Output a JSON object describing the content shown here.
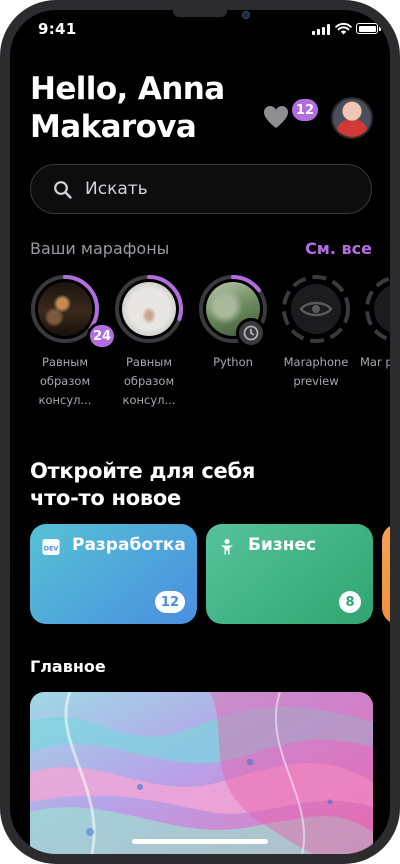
{
  "status_bar": {
    "time": "9:41"
  },
  "header": {
    "greeting_line1": "Hello, Anna",
    "greeting_line2": "Makarova",
    "favorites_count": "12"
  },
  "search": {
    "placeholder": "Искать"
  },
  "marathons": {
    "title": "Ваши марафоны",
    "see_all": "См. все",
    "items": [
      {
        "label": "Равным образом консул...",
        "badge": "24",
        "progress": 0.35
      },
      {
        "label": "Равным образом консул...",
        "progress": 0.3
      },
      {
        "label": "Python",
        "progress": 0.15
      },
      {
        "label": "Maraphone preview"
      },
      {
        "label": "Mar pr"
      }
    ]
  },
  "discover": {
    "title_line1": "Откройте для себя",
    "title_line2": "что-то новое",
    "categories": [
      {
        "name": "Разработка",
        "count": "12",
        "color": "#4c99e0",
        "icon": "dev-icon"
      },
      {
        "name": "Бизнес",
        "count": "8",
        "color": "#3fb388",
        "icon": "person-icon"
      }
    ]
  },
  "main": {
    "title": "Главное"
  },
  "colors": {
    "accent": "#b26ee0",
    "background": "#000000"
  }
}
